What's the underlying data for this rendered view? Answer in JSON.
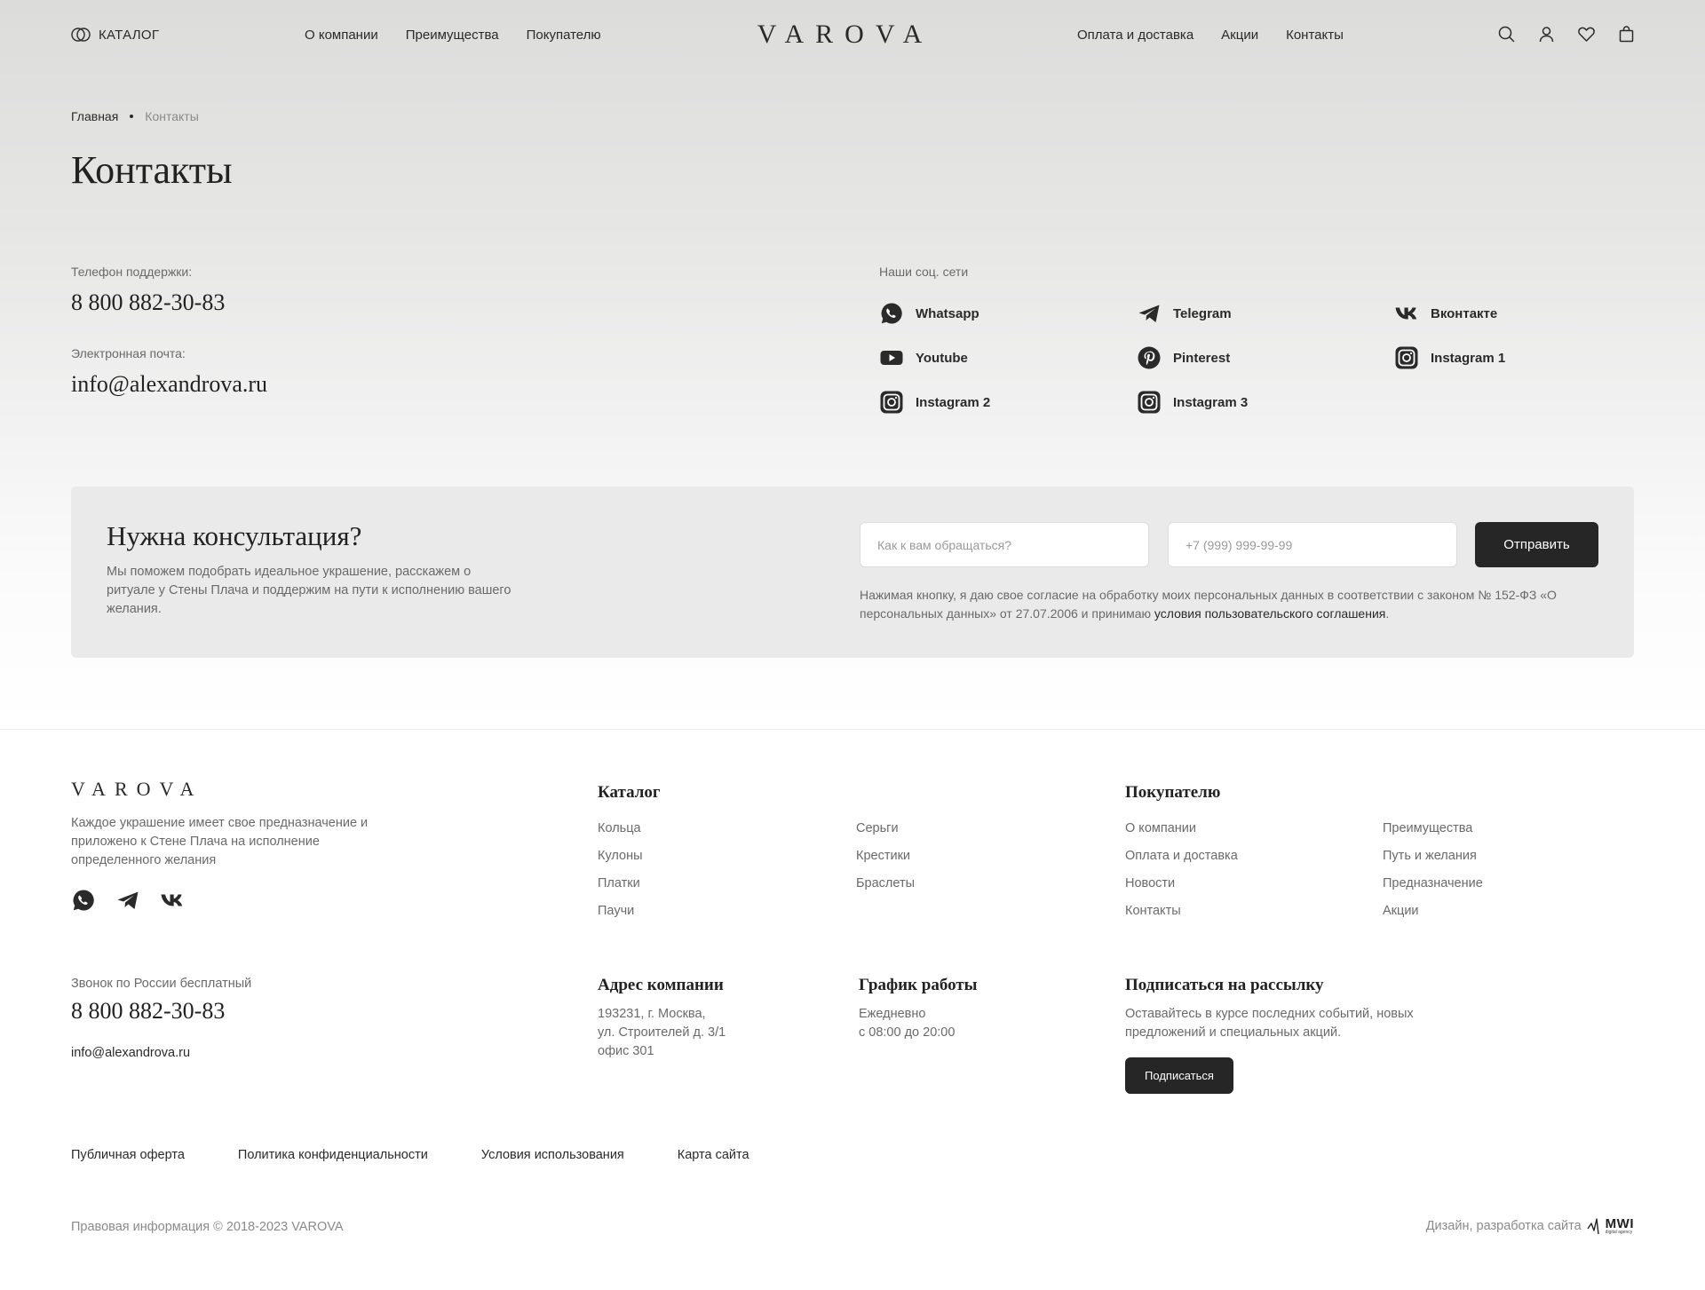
{
  "header": {
    "catalog_label": "КАТАЛОГ",
    "logo": "VAROVA",
    "nav_left": [
      "О компании",
      "Преимущества",
      "Покупателю"
    ],
    "nav_right": [
      "Оплата и доставка",
      "Акции",
      "Контакты"
    ],
    "icons": [
      "search-icon",
      "user-icon",
      "heart-icon",
      "bag-icon"
    ]
  },
  "breadcrumb": {
    "home": "Главная",
    "current": "Контакты"
  },
  "page_title": "Контакты",
  "contacts": {
    "phone_label": "Телефон поддержки:",
    "phone": "8 800 882-30-83",
    "email_label": "Электронная почта:",
    "email": "info@alexandrova.ru"
  },
  "social": {
    "title": "Наши соц. сети",
    "items": [
      {
        "label": "Whatsapp",
        "icon": "whatsapp-icon"
      },
      {
        "label": "Telegram",
        "icon": "telegram-icon"
      },
      {
        "label": "Вконтакте",
        "icon": "vk-icon"
      },
      {
        "label": "Youtube",
        "icon": "youtube-icon"
      },
      {
        "label": "Pinterest",
        "icon": "pinterest-icon"
      },
      {
        "label": "Instagram 1",
        "icon": "instagram-icon"
      },
      {
        "label": "Instagram 2",
        "icon": "instagram-icon"
      },
      {
        "label": "Instagram 3",
        "icon": "instagram-icon"
      }
    ]
  },
  "consultation": {
    "title": "Нужна консультация?",
    "text": "Мы поможем подобрать идеальное украшение, расскажем о ритуале у Стены Плача и поддержим на пути к исполнению вашего желания.",
    "name_placeholder": "Как к вам обращаться?",
    "phone_placeholder": "+7 (999) 999-99-99",
    "submit_label": "Отправить",
    "consent_text": "Нажимая кнопку, я даю свое согласие на обработку моих персональных данных в соответствии с законом № 152-ФЗ «О персональных данных» от 27.07.2006 и принимаю ",
    "consent_link": "условия пользовательского соглашения",
    "consent_end": "."
  },
  "footer": {
    "logo": "VAROVA",
    "about": "Каждое украшение имеет свое предназначение и приложено к Стене Плача на исполнение определенного желания",
    "social_icons": [
      "whatsapp-icon",
      "telegram-icon",
      "vk-icon"
    ],
    "catalog": {
      "title": "Каталог",
      "col1": [
        "Кольца",
        "Кулоны",
        "Платки",
        "Паучи"
      ],
      "col2": [
        "Серьги",
        "Крестики",
        "Браслеты"
      ]
    },
    "buyer": {
      "title": "Покупателю",
      "col1": [
        "О компании",
        "Оплата и доставка",
        "Новости",
        "Контакты"
      ],
      "col2": [
        "Преимущества",
        "Путь и желания",
        "Предназначение",
        "Акции"
      ]
    },
    "call_label": "Звонок по России бесплатный",
    "phone": "8 800 882-30-83",
    "email": "info@alexandrova.ru",
    "address": {
      "title": "Адрес компании",
      "lines": [
        "193231, г. Москва,",
        "ул. Строителей д. 3/1",
        "офис 301"
      ]
    },
    "schedule": {
      "title": "График работы",
      "lines": [
        "Ежедневно",
        "с 08:00 до 20:00"
      ]
    },
    "subscribe": {
      "title": "Подписаться на рассылку",
      "text": "Оставайтесь в курсе последних событий, новых предложений и специальных акций.",
      "button": "Подписаться"
    },
    "legal_links": [
      "Публичная оферта",
      "Политика конфиденциальности",
      "Условия использования",
      "Карта сайта"
    ],
    "copyright": "Правовая информация © 2018-2023 VAROVA",
    "dev_credit": "Дизайн, разработка сайта",
    "dev_logo": "MWI",
    "dev_logo_sub": "digital agency"
  }
}
